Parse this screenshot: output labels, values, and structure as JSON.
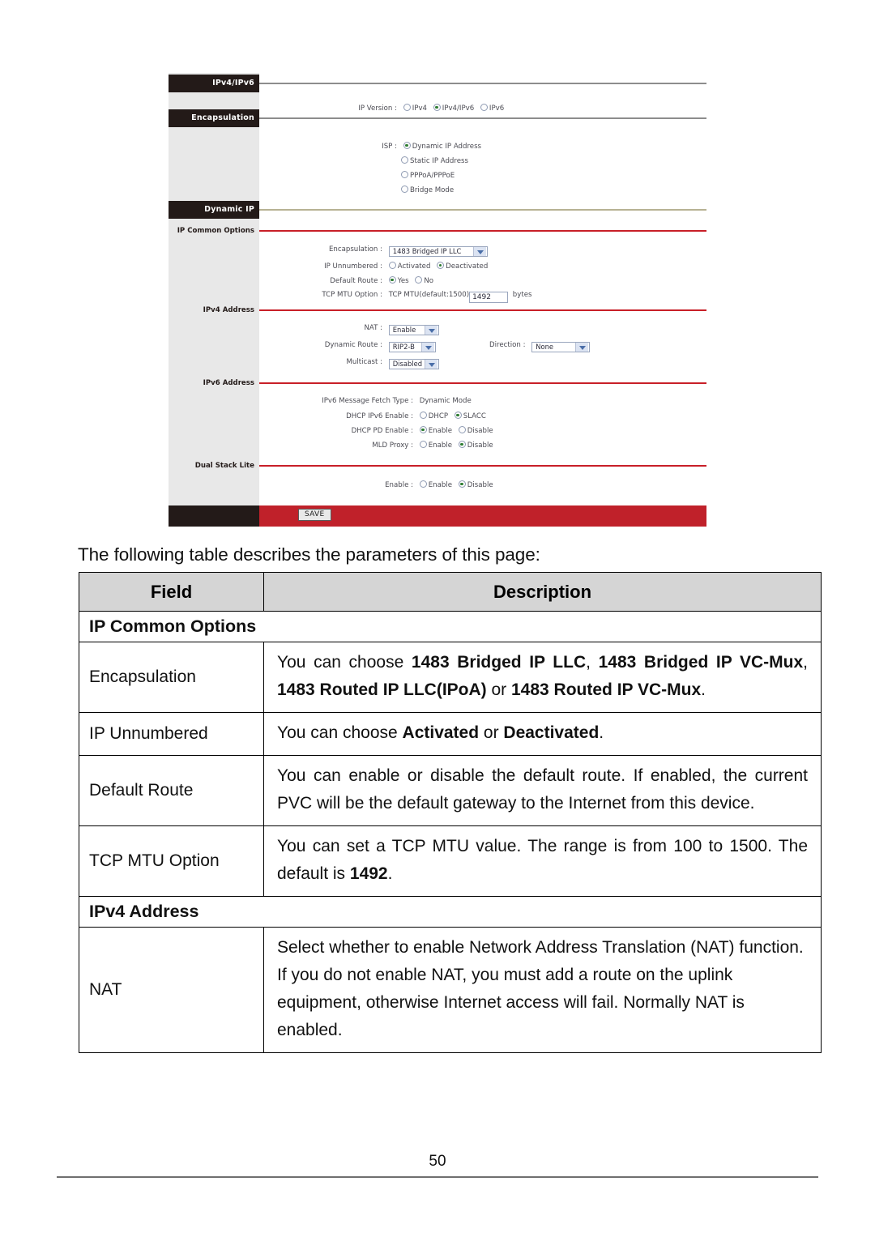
{
  "router_ui": {
    "sections": [
      {
        "name": "IPv4/IPv6",
        "rule": "grey"
      },
      {
        "name": "Encapsulation",
        "rule": "grey"
      },
      {
        "name": "Dynamic IP",
        "rule": "olive"
      }
    ],
    "sidebar_labels": [
      {
        "name": "IP Common Options"
      },
      {
        "name": "IPv4 Address"
      },
      {
        "name": "IPv6 Address"
      },
      {
        "name": "Dual Stack Lite"
      }
    ],
    "ip_version": {
      "label": "IP Version :",
      "options": [
        "IPv4",
        "IPv4/IPv6",
        "IPv6"
      ],
      "selected": "IPv4/IPv6"
    },
    "isp": {
      "label": "ISP :",
      "options": [
        "Dynamic IP Address",
        "Static IP Address",
        "PPPoA/PPPoE",
        "Bridge Mode"
      ],
      "selected": "Dynamic IP Address"
    },
    "ip_common_options": {
      "encapsulation": {
        "label": "Encapsulation :",
        "value": "1483 Bridged IP LLC"
      },
      "ip_unnumbered": {
        "label": "IP Unnumbered :",
        "options": [
          "Activated",
          "Deactivated"
        ],
        "selected": "Deactivated"
      },
      "default_route": {
        "label": "Default Route :",
        "options": [
          "Yes",
          "No"
        ],
        "selected": "Yes"
      },
      "tcp_mtu": {
        "label": "TCP MTU Option :",
        "prefix": "TCP MTU(default:1500)",
        "value": "1492",
        "suffix": "bytes"
      }
    },
    "ipv4_address": {
      "nat": {
        "label": "NAT :",
        "value": "Enable"
      },
      "dynamic_route": {
        "label": "Dynamic Route :",
        "value": "RIP2-B"
      },
      "direction": {
        "label": "Direction :",
        "value": "None"
      },
      "multicast": {
        "label": "Multicast :",
        "value": "Disabled"
      }
    },
    "ipv6_address": {
      "fetch_type": {
        "label": "IPv6 Message Fetch Type :",
        "value": "Dynamic Mode"
      },
      "dhcp_ipv6": {
        "label": "DHCP IPv6 Enable :",
        "options": [
          "DHCP",
          "SLACC"
        ],
        "selected": "SLACC"
      },
      "dhcp_pd": {
        "label": "DHCP PD Enable :",
        "options": [
          "Enable",
          "Disable"
        ],
        "selected": "Enable"
      },
      "mld_proxy": {
        "label": "MLD Proxy :",
        "options": [
          "Enable",
          "Disable"
        ],
        "selected": "Disable"
      }
    },
    "dual_stack_lite": {
      "enable": {
        "label": "Enable :",
        "options": [
          "Enable",
          "Disable"
        ],
        "selected": "Disable"
      }
    },
    "save_button": "SAVE"
  },
  "document": {
    "intro": "The following table describes the parameters of this page:",
    "table": {
      "headers": [
        "Field",
        "Description"
      ],
      "rows": [
        {
          "type": "section",
          "label": "IP Common Options"
        },
        {
          "type": "row",
          "field": "Encapsulation",
          "desc_parts": [
            {
              "t": "You can choose ",
              "b": false
            },
            {
              "t": "1483 Bridged IP LLC",
              "b": true
            },
            {
              "t": ", ",
              "b": false
            },
            {
              "t": "1483 Bridged IP VC-Mux",
              "b": true
            },
            {
              "t": ", ",
              "b": false
            },
            {
              "t": "1483 Routed IP LLC(IPoA)",
              "b": true
            },
            {
              "t": " or ",
              "b": false
            },
            {
              "t": "1483 Routed IP VC-Mux",
              "b": true
            },
            {
              "t": ".",
              "b": false
            }
          ]
        },
        {
          "type": "row",
          "field": "IP Unnumbered",
          "desc_parts": [
            {
              "t": "You can choose ",
              "b": false
            },
            {
              "t": "Activated",
              "b": true
            },
            {
              "t": " or ",
              "b": false
            },
            {
              "t": "Deactivated",
              "b": true
            },
            {
              "t": ".",
              "b": false
            }
          ]
        },
        {
          "type": "row",
          "field": "Default Route",
          "desc_parts": [
            {
              "t": "You can enable or disable the default route. If enabled, the current PVC will be the default gateway to the Internet from this device.",
              "b": false
            }
          ]
        },
        {
          "type": "row",
          "field": "TCP MTU Option",
          "desc_parts": [
            {
              "t": "You can set a TCP MTU value. The range is from 100 to 1500. The default is ",
              "b": false
            },
            {
              "t": "1492",
              "b": true
            },
            {
              "t": ".",
              "b": false
            }
          ]
        },
        {
          "type": "section",
          "label": "IPv4 Address"
        },
        {
          "type": "row",
          "field": "NAT",
          "desc_parts": [
            {
              "t": "Select whether to enable Network Address Translation (NAT) function. If you do not enable NAT, you must add a route on the uplink equipment, otherwise Internet access will fail. Normally NAT is enabled.",
              "b": false
            }
          ]
        }
      ]
    },
    "page_number": "50"
  }
}
